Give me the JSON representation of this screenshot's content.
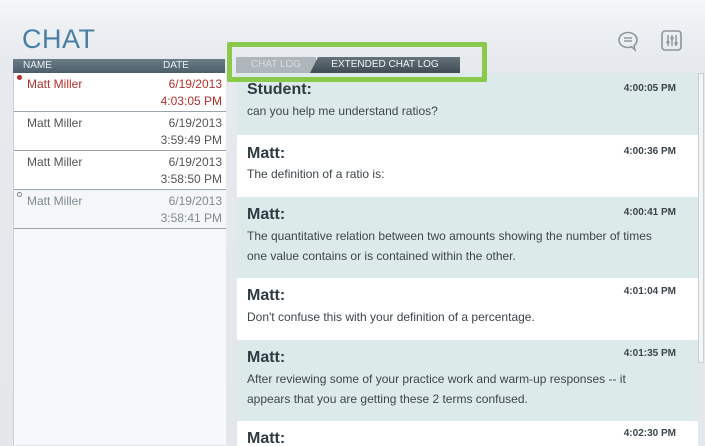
{
  "app": {
    "title": "CHAT"
  },
  "header_icons": [
    "chat-bubble-icon",
    "settings-panel-icon"
  ],
  "conversation_list": {
    "columns": {
      "name": "NAME",
      "date": "DATE"
    },
    "rows": [
      {
        "name": "Matt Miller",
        "date": "6/19/2013",
        "time": "4:03:05 PM",
        "state": "selected",
        "marker": "unread-dot"
      },
      {
        "name": "Matt Miller",
        "date": "6/19/2013",
        "time": "3:59:49 PM",
        "state": "normal",
        "marker": ""
      },
      {
        "name": "Matt Miller",
        "date": "6/19/2013",
        "time": "3:58:50 PM",
        "state": "normal",
        "marker": ""
      },
      {
        "name": "Matt Miller",
        "date": "6/19/2013",
        "time": "3:58:41 PM",
        "state": "dim",
        "marker": "read-circle"
      }
    ]
  },
  "tabs": [
    {
      "label": "CHAT LOG",
      "active": false
    },
    {
      "label": "EXTENDED CHAT LOG",
      "active": true
    }
  ],
  "messages": [
    {
      "sender": "Student:",
      "time": "4:00:05 PM",
      "lines": [
        "can you help me understand ratios?"
      ]
    },
    {
      "sender": "Matt:",
      "time": "4:00:36 PM",
      "lines": [
        "The definition of a ratio is:"
      ]
    },
    {
      "sender": "Matt:",
      "time": "4:00:41 PM",
      "lines": [
        "The quantitative relation between two amounts showing the number of times",
        "one value contains or is contained within the other."
      ]
    },
    {
      "sender": "Matt:",
      "time": "4:01:04 PM",
      "lines": [
        "Don't confuse this with your definition of a percentage."
      ]
    },
    {
      "sender": "Matt:",
      "time": "4:01:35 PM",
      "lines": [
        "After reviewing some of your practice work and warm-up responses -- it",
        "appears that you are getting these 2 terms confused."
      ]
    },
    {
      "sender": "Matt:",
      "time": "4:02:30 PM",
      "lines": []
    }
  ],
  "colors": {
    "accent": "#4a7fa3",
    "highlight": "#8bc94a",
    "selected": "#b4312d",
    "message_alt": "#dceaea"
  }
}
